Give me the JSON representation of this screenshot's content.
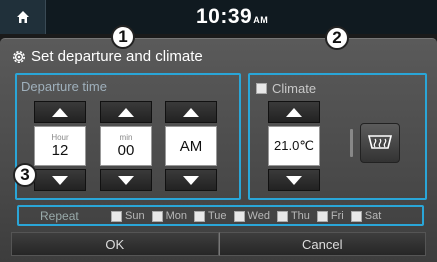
{
  "statusbar": {
    "home_icon": "home-icon",
    "time": "10:39",
    "ampm": "AM"
  },
  "dialog": {
    "title_icon": "gear-icon",
    "title": "Set departure and climate",
    "departure_time": {
      "label": "Departure time",
      "hour": {
        "label": "Hour",
        "value": "12"
      },
      "minute": {
        "label": "min",
        "value": "00"
      },
      "period": {
        "value": "AM"
      }
    },
    "climate": {
      "label": "Climate",
      "checked": false,
      "temperature": "21.0℃",
      "defrost_icon": "rear-defrost-icon"
    },
    "repeat": {
      "label": "Repeat",
      "days": [
        {
          "label": "Sun",
          "checked": false
        },
        {
          "label": "Mon",
          "checked": false
        },
        {
          "label": "Tue",
          "checked": false
        },
        {
          "label": "Wed",
          "checked": false
        },
        {
          "label": "Thu",
          "checked": false
        },
        {
          "label": "Fri",
          "checked": false
        },
        {
          "label": "Sat",
          "checked": false
        }
      ]
    },
    "buttons": {
      "ok": "OK",
      "cancel": "Cancel"
    }
  },
  "callouts": [
    "1",
    "2",
    "3"
  ],
  "colors": {
    "accent": "#2aa6d8",
    "background": "#4a4a4a"
  }
}
